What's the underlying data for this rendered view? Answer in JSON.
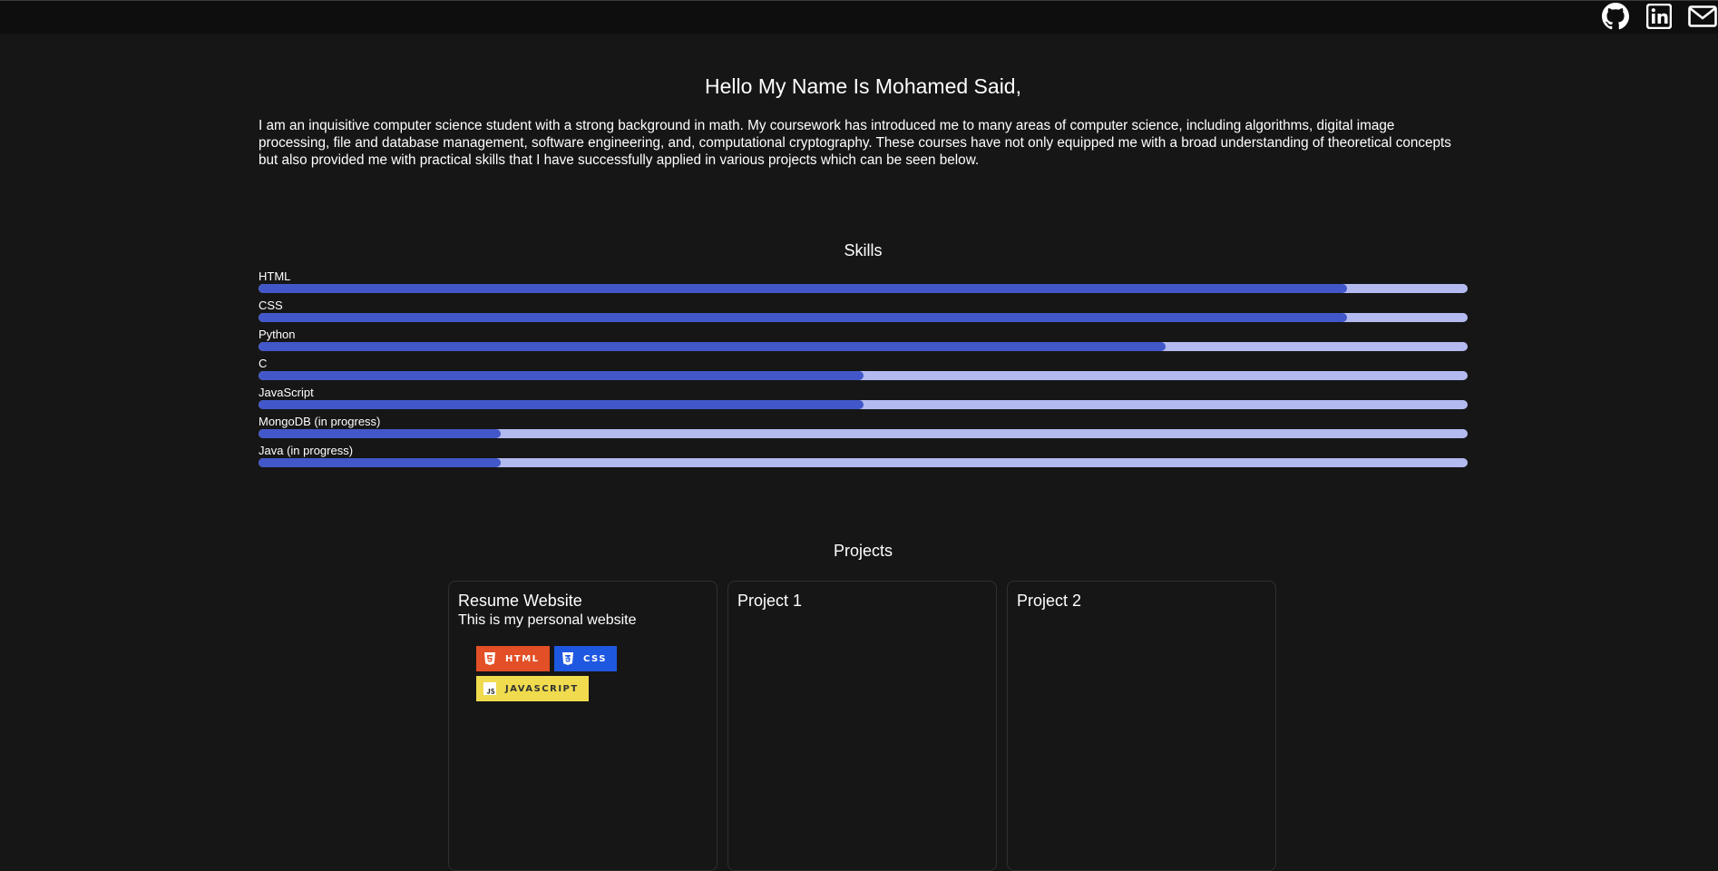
{
  "social": {
    "github_icon": "github-icon",
    "linkedin_icon": "linkedin-icon",
    "email_icon": "envelope-icon"
  },
  "intro": {
    "greeting": "Hello My Name Is Mohamed Said,",
    "about": "I am an inquisitive computer science student with a strong background in math. My coursework has introduced me to many areas of computer science, including algorithms, digital image processing, file and database management, software engineering, and, computational cryptography. These courses have not only equipped me with a broad understanding of theoretical concepts but also provided me with practical skills that I have successfully applied in various projects which can be seen below."
  },
  "skills": {
    "title": "Skills",
    "items": [
      {
        "name": "HTML",
        "level": 0.9
      },
      {
        "name": "CSS",
        "level": 0.9
      },
      {
        "name": "Python",
        "level": 0.75
      },
      {
        "name": "C",
        "level": 0.5
      },
      {
        "name": "JavaScript",
        "level": 0.5
      },
      {
        "name": "MongoDB (in progress)",
        "level": 0.2
      },
      {
        "name": "Java (in progress)",
        "level": 0.2
      }
    ],
    "fill_color": "#4257c9",
    "track_color": "#b3baf0"
  },
  "projects": {
    "title": "Projects",
    "cards": [
      {
        "title": "Resume Website",
        "description": "This is my personal website",
        "badges": [
          {
            "label": "HTML",
            "icon": "html5-icon",
            "color": "#e34f26"
          },
          {
            "label": "CSS",
            "icon": "css3-icon",
            "color": "#1f58e0"
          },
          {
            "label": "JAVASCRIPT",
            "icon": "javascript-icon",
            "color": "#f0db4f"
          }
        ]
      },
      {
        "title": "Project 1"
      },
      {
        "title": "Project 2"
      }
    ]
  },
  "colors": {
    "background": "#161616",
    "topbar": "#0e0e0e",
    "text": "#ffffff"
  }
}
